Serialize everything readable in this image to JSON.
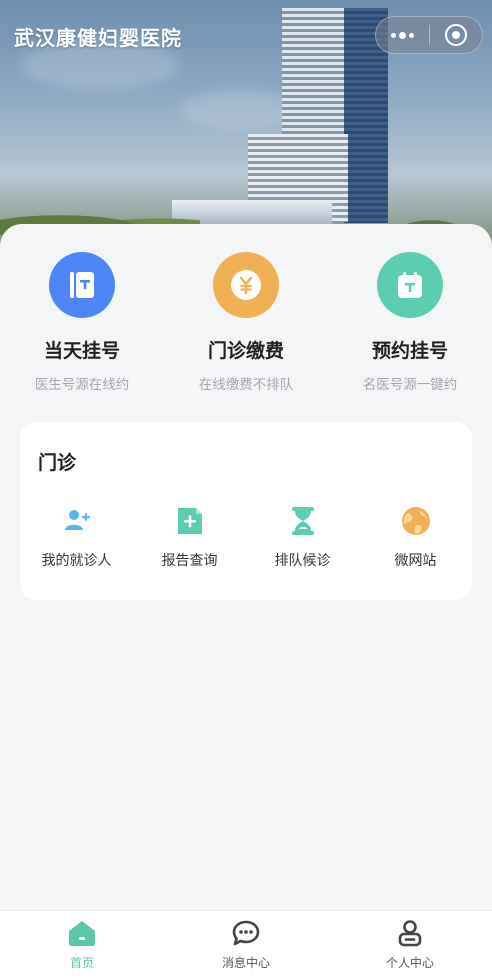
{
  "header": {
    "title": "武汉康健妇婴医院"
  },
  "capsule": {
    "more_icon": "more-dots-icon",
    "close_icon": "target-close-icon"
  },
  "services": [
    {
      "title": "当天挂号",
      "subtitle": "医生号源在线约",
      "icon": "register-book-icon",
      "color": "#4f86f7"
    },
    {
      "title": "门诊缴费",
      "subtitle": "在线缴费不排队",
      "icon": "yuan-coin-icon",
      "color": "#f2b055"
    },
    {
      "title": "预约挂号",
      "subtitle": "名医号源一键约",
      "icon": "calendar-icon",
      "color": "#5ccdb0"
    }
  ],
  "outpatient": {
    "title": "门诊",
    "items": [
      {
        "label": "我的就诊人",
        "icon": "add-person-icon",
        "color": "#5ab8e8"
      },
      {
        "label": "报告查询",
        "icon": "report-document-icon",
        "color": "#5ccdb0"
      },
      {
        "label": "排队候诊",
        "icon": "hourglass-icon",
        "color": "#5ccdb0"
      },
      {
        "label": "微网站",
        "icon": "globe-icon",
        "color": "#f2b055"
      }
    ]
  },
  "tabbar": {
    "tabs": [
      {
        "label": "首页",
        "icon": "home-icon",
        "active": true
      },
      {
        "label": "消息中心",
        "icon": "message-bubble-icon",
        "active": false
      },
      {
        "label": "个人中心",
        "icon": "user-profile-icon",
        "active": false
      }
    ],
    "active_color": "#5cc7a8",
    "inactive_color": "#555555"
  }
}
